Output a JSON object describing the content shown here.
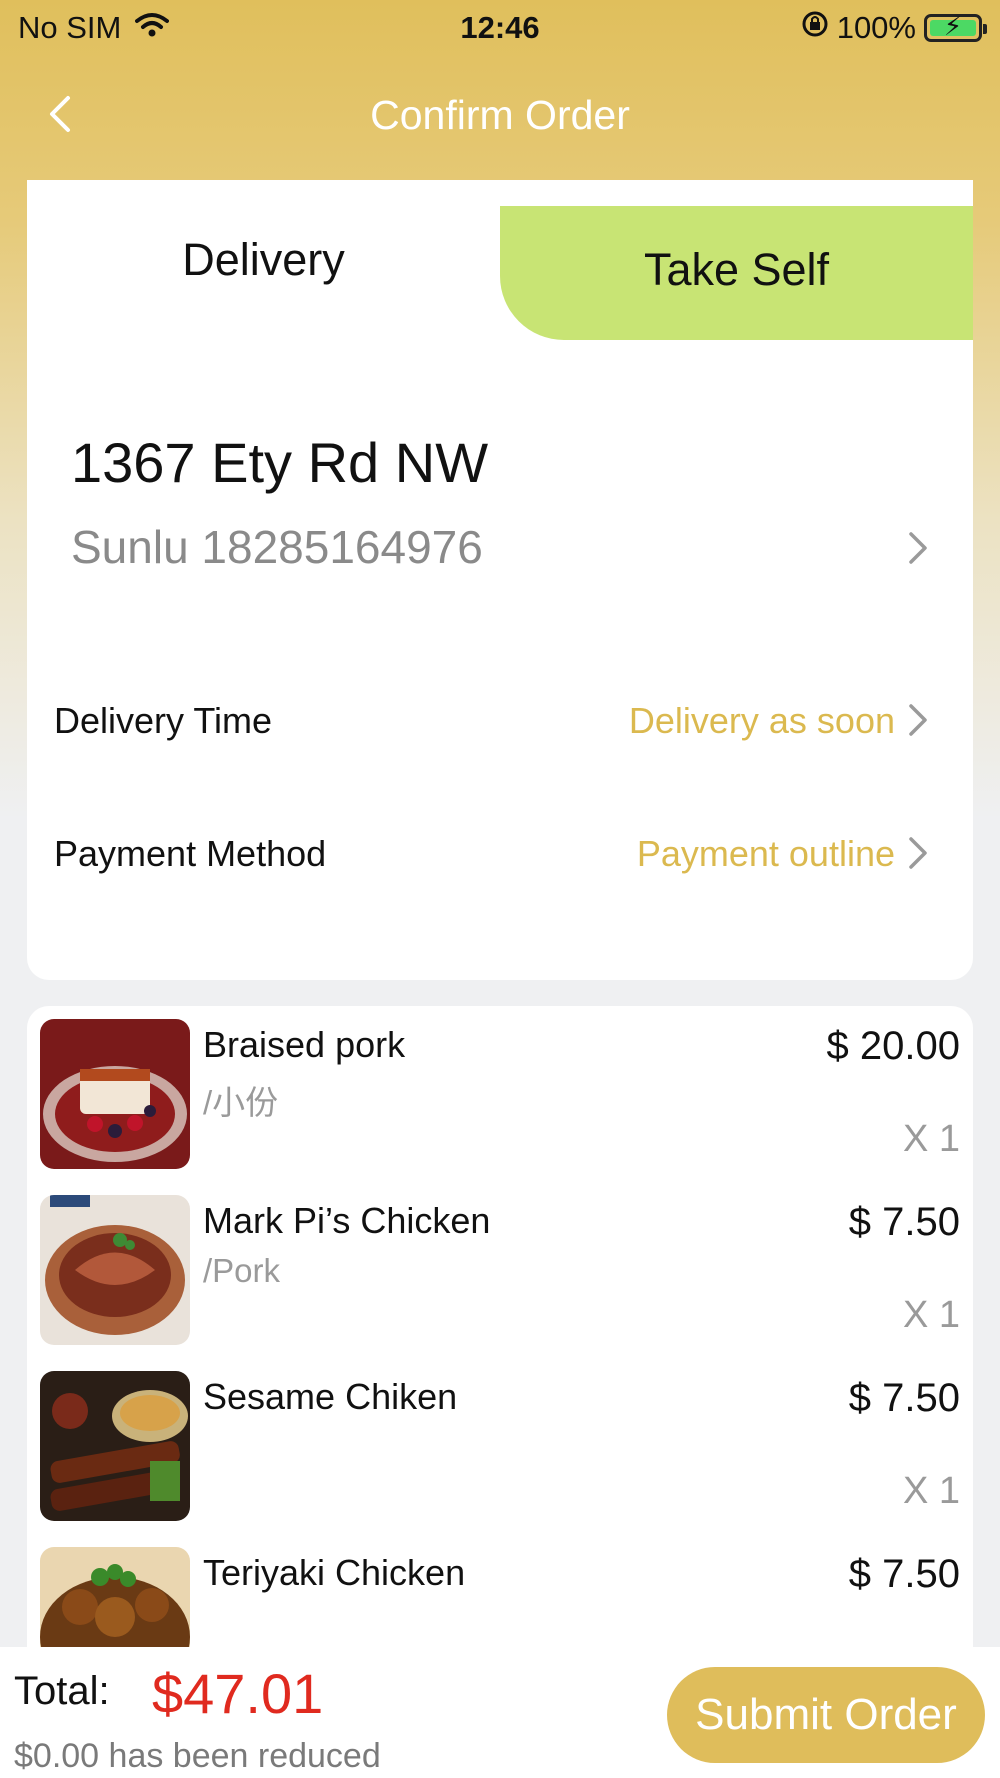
{
  "status_bar": {
    "carrier": "No SIM",
    "time": "12:46",
    "battery_percent": "100%",
    "battery_level": 1.0,
    "icons": [
      "wifi-icon",
      "orientation-lock-icon",
      "battery-charging-icon"
    ]
  },
  "nav": {
    "title": "Confirm Order",
    "back_icon": "chevron-left-icon"
  },
  "tabs": {
    "delivery": "Delivery",
    "take_self": "Take Self",
    "active": "Delivery"
  },
  "address": {
    "line": "1367 Ety Rd NW",
    "contact": "Sunlu 18285164976"
  },
  "settings": {
    "delivery_time": {
      "label": "Delivery Time",
      "value": "Delivery as soon"
    },
    "payment_method": {
      "label": "Payment Method",
      "value": "Payment outline"
    }
  },
  "items": [
    {
      "name": "Braised pork",
      "spec": "/小份",
      "price": "$ 20.00",
      "qty": "X 1"
    },
    {
      "name": "Mark Pi’s Chicken",
      "spec": "/Pork",
      "price": "$ 7.50",
      "qty": "X 1"
    },
    {
      "name": "Sesame Chiken",
      "spec": "",
      "price": "$ 7.50",
      "qty": "X 1"
    },
    {
      "name": "Teriyaki Chicken",
      "spec": "",
      "price": "$ 7.50",
      "qty": ""
    }
  ],
  "footer": {
    "total_label": "Total:",
    "total_value": "$47.01",
    "reduced_text": "$0.00 has been reduced",
    "submit_label": "Submit Order"
  },
  "colors": {
    "accent": "#dfbd5b",
    "tab_inactive": "#c8e474",
    "price_red": "#e02a1f",
    "value_gold": "#dbb94f"
  }
}
